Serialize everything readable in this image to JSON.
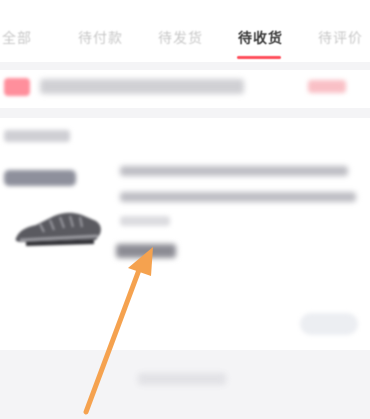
{
  "tabs": [
    {
      "label": "全部",
      "active": false
    },
    {
      "label": "待付款",
      "active": false
    },
    {
      "label": "待发货",
      "active": false
    },
    {
      "label": "待收货",
      "active": true
    },
    {
      "label": "待评价",
      "active": false
    }
  ],
  "colors": {
    "accent": "#ff4d5a",
    "arrow": "#f5a24f",
    "page_background": "#f4f4f6"
  },
  "annotation": {
    "icon": "arrow-pointer-icon"
  }
}
